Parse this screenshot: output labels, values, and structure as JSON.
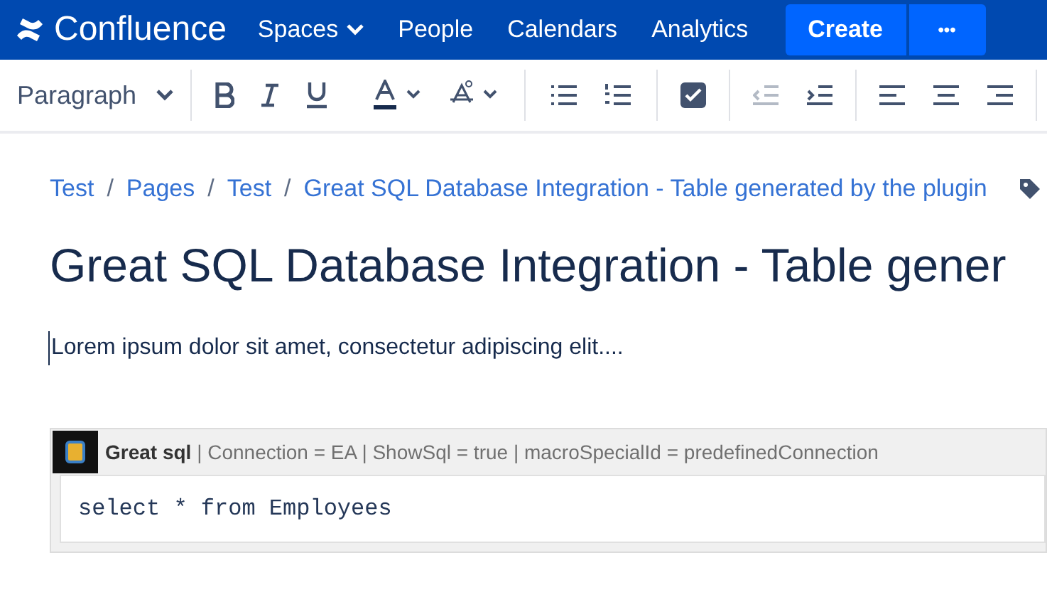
{
  "navbar": {
    "logo": "Confluence",
    "items": [
      {
        "label": "Spaces",
        "dropdown": true
      },
      {
        "label": "People",
        "dropdown": false
      },
      {
        "label": "Calendars",
        "dropdown": false
      },
      {
        "label": "Analytics",
        "dropdown": false
      }
    ],
    "create_button": "Create",
    "more_button": "•••"
  },
  "toolbar": {
    "style_dropdown": "Paragraph"
  },
  "breadcrumbs": [
    {
      "kind": "link",
      "text": "Test"
    },
    {
      "kind": "separator",
      "text": "/"
    },
    {
      "kind": "link",
      "text": "Pages"
    },
    {
      "kind": "separator",
      "text": "/"
    },
    {
      "kind": "link",
      "text": "Test"
    },
    {
      "kind": "separator",
      "text": "/"
    },
    {
      "kind": "link",
      "text": "Great SQL Database Integration - Table generated by the plugin"
    }
  ],
  "title": "Great SQL Database Integration - Table gener",
  "paragraph": "Lorem ipsum dolor sit amet, consectetur adipiscing elit....",
  "macro": {
    "header": "**Great sql** | Connection = EA | ShowSql = true | macroSpecialId = predefinedConnection",
    "code": "select * from Employees"
  }
}
